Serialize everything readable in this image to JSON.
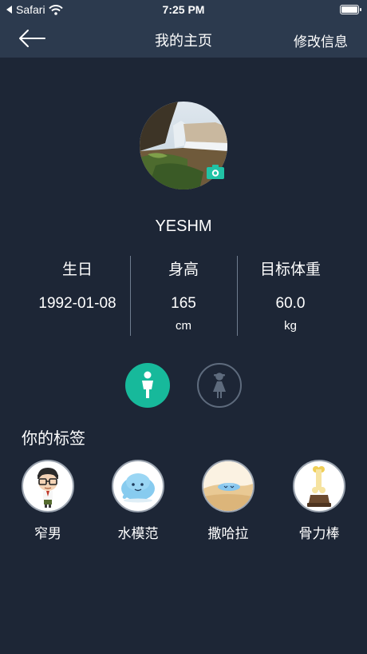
{
  "status_bar": {
    "back_app": "Safari",
    "time": "7:25 PM"
  },
  "nav": {
    "title": "我的主页",
    "edit_label": "修改信息"
  },
  "profile": {
    "username": "YESHM"
  },
  "stats": [
    {
      "label": "生日",
      "value": "1992-01-08",
      "unit": ""
    },
    {
      "label": "身高",
      "value": "165",
      "unit": "cm"
    },
    {
      "label": "目标体重",
      "value": "60.0",
      "unit": "kg"
    }
  ],
  "gender": {
    "selected": "male"
  },
  "tags_section": {
    "title": "你的标签"
  },
  "tags": [
    {
      "label": "窄男",
      "icon": "cartoon-boy-icon"
    },
    {
      "label": "水模范",
      "icon": "blue-blob-icon"
    },
    {
      "label": "撒哈拉",
      "icon": "melting-blob-desert-icon"
    },
    {
      "label": "骨力棒",
      "icon": "bone-trophy-icon"
    }
  ],
  "colors": {
    "background": "#1d2636",
    "header": "#2c3a4e",
    "accent": "#17b99b",
    "camera": "#21c3a6"
  }
}
